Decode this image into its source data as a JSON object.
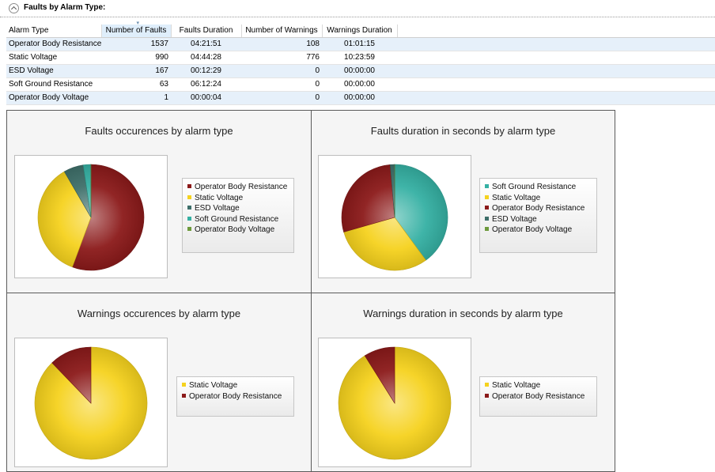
{
  "section": {
    "title": "Faults by Alarm Type:"
  },
  "table": {
    "columns": [
      "Alarm Type",
      "Number of Faults",
      "Faults Duration",
      "Number of Warnings",
      "Warnings Duration"
    ],
    "rows": [
      [
        "Operator Body Resistance",
        "1537",
        "04:21:51",
        "108",
        "01:01:15"
      ],
      [
        "Static Voltage",
        "990",
        "04:44:28",
        "776",
        "10:23:59"
      ],
      [
        "ESD Voltage",
        "167",
        "00:12:29",
        "0",
        "00:00:00"
      ],
      [
        "Soft Ground Resistance",
        "63",
        "06:12:24",
        "0",
        "00:00:00"
      ],
      [
        "Operator Body Voltage",
        "1",
        "00:00:04",
        "0",
        "00:00:00"
      ]
    ]
  },
  "colors": {
    "Operator Body Resistance": "#8b1a1a",
    "Static Voltage": "#f5d21e",
    "ESD Voltage": "#3e6f6a",
    "Soft Ground Resistance": "#35b0a3",
    "Operator Body Voltage": "#6d9a3c"
  },
  "chart_data": [
    {
      "type": "pie",
      "title": "Faults occurences by alarm type",
      "labels": [
        "Operator Body Resistance",
        "Static Voltage",
        "ESD Voltage",
        "Soft Ground Resistance",
        "Operator Body Voltage"
      ],
      "values": [
        1537,
        990,
        167,
        63,
        1
      ],
      "legend": "right"
    },
    {
      "type": "pie",
      "title": "Faults duration in seconds by alarm type",
      "labels": [
        "Soft Ground Resistance",
        "Static Voltage",
        "Operator Body Resistance",
        "ESD Voltage",
        "Operator Body Voltage"
      ],
      "values": [
        22344,
        17068,
        15711,
        749,
        4
      ],
      "legend": "right"
    },
    {
      "type": "pie",
      "title": "Warnings occurences by alarm type",
      "labels": [
        "Static Voltage",
        "Operator Body Resistance"
      ],
      "values": [
        776,
        108
      ],
      "legend": "right"
    },
    {
      "type": "pie",
      "title": "Warnings duration in seconds by alarm type",
      "labels": [
        "Static Voltage",
        "Operator Body Resistance"
      ],
      "values": [
        37439,
        3675
      ],
      "legend": "right"
    }
  ]
}
